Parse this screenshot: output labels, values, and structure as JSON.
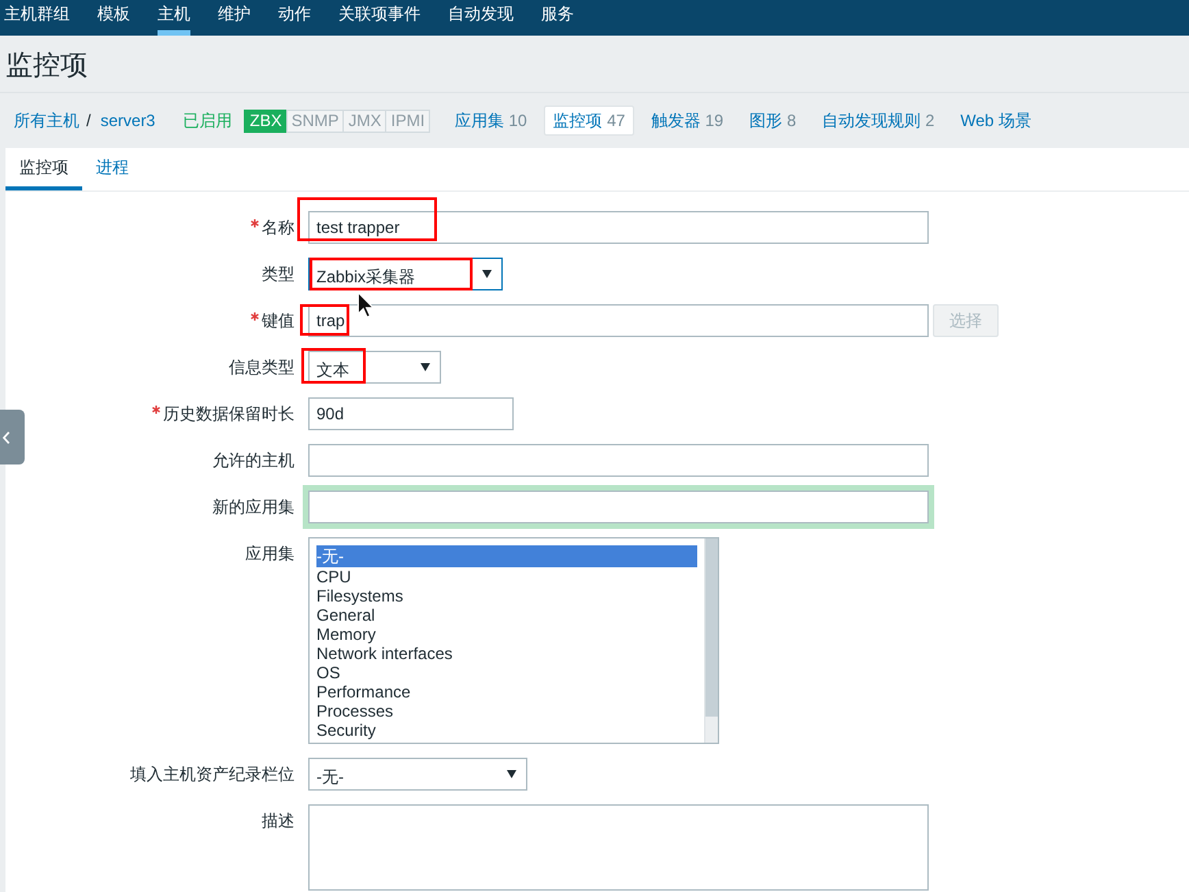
{
  "top_nav": [
    {
      "label": "主机群组",
      "selected": false
    },
    {
      "label": "模板",
      "selected": false
    },
    {
      "label": "主机",
      "selected": true
    },
    {
      "label": "维护",
      "selected": false
    },
    {
      "label": "动作",
      "selected": false
    },
    {
      "label": "关联项事件",
      "selected": false
    },
    {
      "label": "自动发现",
      "selected": false
    },
    {
      "label": "服务",
      "selected": false
    }
  ],
  "page_title": "监控项",
  "host_bar": {
    "breadcrumbs": [
      {
        "label": "所有主机"
      },
      {
        "label": "server3"
      }
    ],
    "separator": "/",
    "status": {
      "label": "已启用",
      "enabled": true
    },
    "availability": [
      {
        "label": "ZBX",
        "on": true
      },
      {
        "label": "SNMP",
        "on": false
      },
      {
        "label": "JMX",
        "on": false
      },
      {
        "label": "IPMI",
        "on": false
      }
    ],
    "tabs": [
      {
        "label": "应用集",
        "count": "10",
        "selected": false
      },
      {
        "label": "监控项",
        "count": "47",
        "selected": true
      },
      {
        "label": "触发器",
        "count": "19",
        "selected": false
      },
      {
        "label": "图形",
        "count": "8",
        "selected": false
      },
      {
        "label": "自动发现规则",
        "count": "2",
        "selected": false
      },
      {
        "label": "Web 场景",
        "selected": false
      }
    ]
  },
  "form_tabs": [
    {
      "label": "监控项",
      "selected": true
    },
    {
      "label": "进程",
      "selected": false
    }
  ],
  "form": {
    "fields": [
      {
        "kind": "text",
        "label": "名称",
        "required": true,
        "value": "test trapper",
        "focused": false,
        "emphasized": false,
        "highlighted": true
      },
      {
        "kind": "select",
        "label": "类型",
        "required": false,
        "value": "Zabbix采集器",
        "focused": true,
        "emphasized": false,
        "highlighted": true
      },
      {
        "kind": "text",
        "label": "键值",
        "required": true,
        "value": "trap",
        "focused": false,
        "emphasized": false,
        "highlighted": true,
        "button": {
          "label": "选择",
          "disabled": true
        }
      },
      {
        "kind": "select",
        "label": "信息类型",
        "required": false,
        "value": "文本",
        "focused": false,
        "emphasized": false,
        "highlighted": true
      },
      {
        "kind": "text",
        "label": "历史数据保留时长",
        "required": true,
        "value": "90d",
        "focused": false,
        "emphasized": false,
        "highlighted": false
      },
      {
        "kind": "text",
        "label": "允许的主机",
        "required": false,
        "focused": false,
        "emphasized": false,
        "highlighted": false
      },
      {
        "kind": "text",
        "label": "新的应用集",
        "required": false,
        "focused": false,
        "emphasized": true,
        "highlighted": false
      },
      {
        "kind": "listbox",
        "label": "应用集",
        "required": false,
        "focused": false,
        "emphasized": false,
        "highlighted": false,
        "options": [
          {
            "label": "-无-",
            "selected": true
          },
          {
            "label": "CPU",
            "selected": false
          },
          {
            "label": "Filesystems",
            "selected": false
          },
          {
            "label": "General",
            "selected": false
          },
          {
            "label": "Memory",
            "selected": false
          },
          {
            "label": "Network interfaces",
            "selected": false
          },
          {
            "label": "OS",
            "selected": false
          },
          {
            "label": "Performance",
            "selected": false
          },
          {
            "label": "Processes",
            "selected": false
          },
          {
            "label": "Security",
            "selected": false
          }
        ]
      },
      {
        "kind": "select",
        "label": "填入主机资产纪录栏位",
        "required": false,
        "value": "-无-",
        "focused": false,
        "emphasized": false,
        "highlighted": false
      },
      {
        "kind": "textarea",
        "label": "描述",
        "required": false,
        "focused": false,
        "emphasized": false,
        "highlighted": false
      }
    ]
  }
}
